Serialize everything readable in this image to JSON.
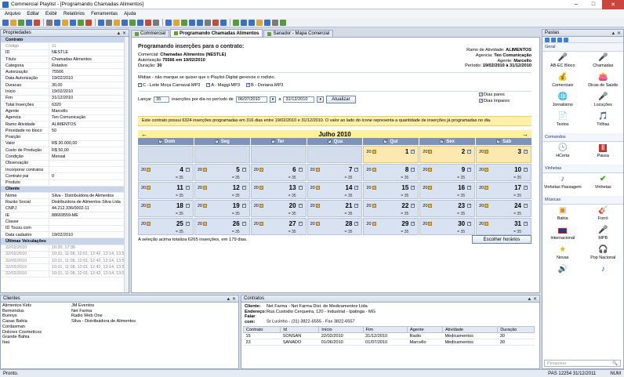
{
  "window": {
    "title": "Commercial Playlist - [Programando Chamadas Alimentos]"
  },
  "menu": [
    "Arquivo",
    "Editar",
    "Exibir",
    "Relatórios",
    "Ferramentas",
    "Ajuda"
  ],
  "props": {
    "title": "Propriedades",
    "rows": [
      {
        "type": "section",
        "k": "Contrato"
      },
      {
        "k": "Código",
        "v": "11",
        "dis": true
      },
      {
        "k": "ID",
        "v": "NESTLE"
      },
      {
        "k": "Título",
        "v": "Chamadas Alimentos"
      },
      {
        "k": "Categoria",
        "v": "Rotativo"
      },
      {
        "k": "Autorização",
        "v": "75566"
      },
      {
        "k": "Data Autorização",
        "v": "19/02/2010"
      },
      {
        "k": "Duracao",
        "v": "30,00"
      },
      {
        "k": "Inicio",
        "v": "19/02/2010"
      },
      {
        "k": "Fim",
        "v": "31/12/2010"
      },
      {
        "k": "Total Inserções",
        "v": "6320"
      },
      {
        "k": "Agente",
        "v": "Marcello"
      },
      {
        "k": "Agencia",
        "v": "Ten Comunicação"
      },
      {
        "k": "Ramo Atividade",
        "v": "ALIMENTOS"
      },
      {
        "k": "Prioridade no bloco",
        "v": "50"
      },
      {
        "k": "Posição",
        "v": ""
      },
      {
        "k": "Valor",
        "v": "R$ 30.000,00"
      },
      {
        "k": "Custo de Produção",
        "v": "R$ 50,00"
      },
      {
        "k": "Condição",
        "v": "Mensal"
      },
      {
        "k": "Observação",
        "v": ""
      },
      {
        "k": "Incorporar contratos",
        "v": ""
      },
      {
        "k": "Contrato pai",
        "v": "0"
      },
      {
        "k": "Produto",
        "v": ""
      },
      {
        "type": "section",
        "k": "Cliente"
      },
      {
        "k": "Nome",
        "v": "Silva - Distribuidora de Alimentos"
      },
      {
        "k": "Razão Social",
        "v": "Distribuidora de Alimentos Silva Ltda"
      },
      {
        "k": "CNPJ",
        "v": "44.212.336/0002-11"
      },
      {
        "k": "IE",
        "v": "88669559-ME"
      },
      {
        "k": "Classe",
        "v": ""
      },
      {
        "k": "ID Tocou.com",
        "v": ""
      },
      {
        "k": "Data cadastro",
        "v": "19/02/2010"
      },
      {
        "type": "section",
        "k": "Últimas Veiculações"
      },
      {
        "k": "22/02/2010",
        "v": "16:30, 17:35",
        "dis": true,
        "gray": true
      },
      {
        "k": "22/02/2010",
        "v": "10:31, 11:08, 12:01, 12:42, 13:14, 13:52",
        "dis": true,
        "gray": true
      },
      {
        "k": "22/02/2010",
        "v": "10:31, 11:08, 12:01, 12:42, 13:14, 13:52",
        "dis": true,
        "gray": true
      },
      {
        "k": "22/02/2010",
        "v": "10:31, 11:08, 12:01, 12:42, 13:14, 13:52",
        "dis": true,
        "gray": true
      },
      {
        "k": "22/02/2010",
        "v": "10:31, 11:08, 12:01, 12:42, 13:14, 13:52",
        "dis": true,
        "gray": true
      }
    ]
  },
  "tabs": [
    {
      "label": "Commercial"
    },
    {
      "label": "Programando Chamadas Alimentos",
      "active": true
    },
    {
      "label": "Sanador - Mapa Comercial"
    }
  ],
  "doc": {
    "heading": "Programando inserções para o contrato:",
    "left": [
      {
        "label": "Comercial:",
        "value": "Chamadas Alimentos (NESTLE)"
      },
      {
        "label": "Autorização",
        "value": "75566 em 19/02/2010"
      },
      {
        "label": "Duração:",
        "value": "30"
      }
    ],
    "right": [
      {
        "label": "Ramo de Atividade:",
        "value": "ALIMENTOS"
      },
      {
        "label": "Agencia:",
        "value": "Ten Comunicação"
      },
      {
        "label": "Agente:",
        "value": "Marcello"
      },
      {
        "label": "Período:",
        "value": "19/02/2010 à 31/12/2010"
      }
    ],
    "midias_note": "Mídias - não marque se quiser que o Playlist Digital gerencie o rodízio.",
    "midias": [
      "C - Leite Moça Carnaval.MP3",
      "A - Maggi.MP3",
      "B - Doriana.MP3"
    ],
    "lancar_label": "Lançar",
    "lancar_value": "35",
    "insercoes_label": "inserções por dia no período de",
    "date_from": "06/07/2010",
    "date_sep": "a",
    "date_to": "31/12/2010",
    "atualizar": "Atualizar",
    "dias_pares": "Dias pares",
    "dias_impares": "Dias ímpares",
    "banner": "Este contrato possui 6324 inserções programadas em 316 dias entre 19/02/2010 e 31/12/2010. O valor ao lado do ícone representa a quantidade de inserções já programadas no dia.",
    "month": "Julho 2010",
    "prev": "←",
    "next": "→",
    "dows": [
      "Dom",
      "Seg",
      "Ter",
      "Qua",
      "Qui",
      "Sex",
      "Sáb"
    ],
    "n20": "20",
    "n35": "35",
    "footer": "A seleção acima totaliza 6265 inserções, em 179 dias.",
    "escolher": "Escolher horários"
  },
  "pastas": {
    "title": "Pastas",
    "groups": [
      {
        "name": "Geral",
        "items": [
          {
            "label": "AB-EC Bloco",
            "icon": "microphone"
          },
          {
            "label": "Chamadas",
            "icon": "microphone"
          },
          {
            "label": "Comerciais",
            "icon": "money-bag"
          },
          {
            "label": "Dicas de Saúde",
            "icon": "wallet"
          },
          {
            "label": "Jornalismo",
            "icon": "globe"
          },
          {
            "label": "Locuções",
            "icon": "microphone"
          },
          {
            "label": "Textos",
            "icon": "text-doc"
          },
          {
            "label": "Trilhas",
            "icon": "music-box"
          }
        ]
      },
      {
        "name": "Comandos",
        "items": [
          {
            "label": "HCerta",
            "icon": "clock-doc"
          },
          {
            "label": "Pausa",
            "icon": "pause-red"
          }
        ]
      },
      {
        "name": "Vinhetas",
        "items": [
          {
            "label": "Vinhetas Passagem",
            "icon": "note-blue"
          },
          {
            "label": "Vinhetas",
            "icon": "check-green"
          }
        ]
      },
      {
        "name": "Músicas",
        "items": [
          {
            "label": "Bahia",
            "icon": "folder-orange"
          },
          {
            "label": "Forró",
            "icon": "guitar"
          },
          {
            "label": "Internacional",
            "icon": "flag-uk"
          },
          {
            "label": "MPB",
            "icon": "microphone"
          },
          {
            "label": "Novas",
            "icon": "star"
          },
          {
            "label": "Pop Nacional",
            "icon": "headphones"
          },
          {
            "label": "",
            "icon": "speaker"
          },
          {
            "label": "",
            "icon": "note-blue"
          }
        ]
      }
    ],
    "search": "Pesquisar"
  },
  "clientes": {
    "title": "Clientes",
    "col1": [
      "Alimentos Kids",
      "Bemvindus",
      "Bunnys",
      "Casas Bahia",
      "Cordasman",
      "Dolores Cosmeticos",
      "Grande Bahia",
      "Itaú"
    ],
    "col2": [
      "JM Eventos",
      "Net Farma",
      "Radio Web One",
      "Silva - Distribuidora de Alimentos"
    ]
  },
  "contratos": {
    "title": "Contratos",
    "cliente": "Net Farma - Net Farma Dist. de Medicamentos Ltda",
    "endereco": "Rua Custodio Cerqueira, 120 - Industrial - Ipatinga - MG",
    "falar": "Sr Lucinho - (31) 3822-6555 - Fax 3822-6557",
    "lab_cliente": "Cliente:",
    "lab_endereco": "Endereço:",
    "lab_falar": "Falar com:",
    "headers": [
      "Contrato",
      "Id",
      "Início",
      "Fim",
      "Agente",
      "Atividade",
      "Duração"
    ],
    "rows": [
      [
        "15",
        "SONSAN",
        "22/02/2010",
        "31/12/2010",
        "Radio",
        "Medicamentos",
        "30"
      ],
      [
        "23",
        "SANADO",
        "01/06/2010",
        "01/07/2010",
        "Marcello",
        "Medicamentos",
        "30"
      ]
    ]
  },
  "status": {
    "left": "Pronto.",
    "pas": "PAS 12254 31/12/2011",
    "num": "NUM"
  }
}
